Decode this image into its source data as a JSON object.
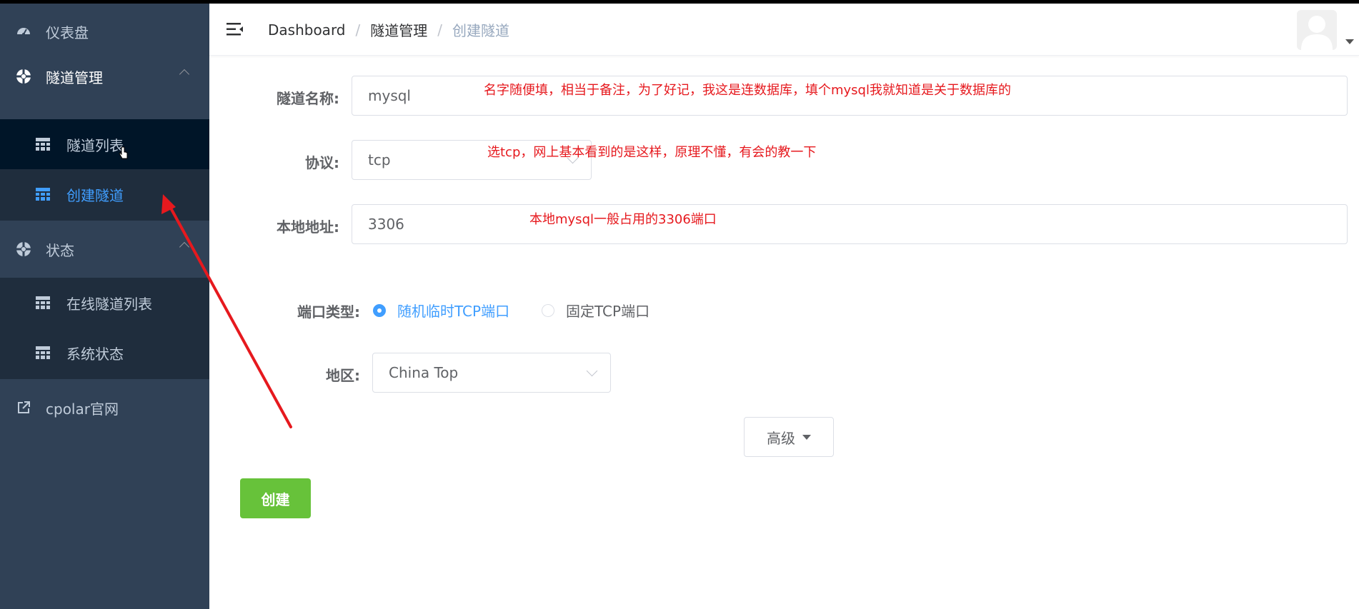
{
  "sidebar": {
    "dashboard": {
      "label": "仪表盘",
      "icon": "dashboard-icon"
    },
    "tunnel_mgmt": {
      "label": "隧道管理",
      "icon": "lifebuoy-icon"
    },
    "tunnel_list": {
      "label": "隧道列表",
      "icon": "table-icon"
    },
    "create_tunnel": {
      "label": "创建隧道",
      "icon": "table-icon"
    },
    "status": {
      "label": "状态",
      "icon": "lifebuoy-icon"
    },
    "online_tunnels": {
      "label": "在线隧道列表",
      "icon": "table-icon"
    },
    "system_status": {
      "label": "系统状态",
      "icon": "table-icon"
    },
    "official_site": {
      "label": "cpolar官网",
      "icon": "external-link-icon"
    }
  },
  "header": {
    "breadcrumb": [
      "Dashboard",
      "隧道管理",
      "创建隧道"
    ],
    "separator": "/"
  },
  "form": {
    "name": {
      "label": "隧道名称:",
      "value": "mysql",
      "note": "名字随便填，相当于备注，为了好记，我这是连数据库，填个mysql我就知道是关于数据库的"
    },
    "protocol": {
      "label": "协议:",
      "value": "tcp",
      "note": "选tcp，网上基本看到的是这样，原理不懂，有会的教一下"
    },
    "local_addr": {
      "label": "本地地址:",
      "value": "3306",
      "note": "本地mysql一般占用的3306端口"
    },
    "port_type": {
      "label": "端口类型:",
      "options": [
        "随机临时TCP端口",
        "固定TCP端口"
      ],
      "selected": "随机临时TCP端口"
    },
    "region": {
      "label": "地区:",
      "value": "China Top"
    },
    "advanced_label": "高级",
    "create_label": "创建"
  },
  "colors": {
    "sidebar_bg": "#304156",
    "submenu_bg": "#1f2d3d",
    "active": "#409eff",
    "annotation": "#e6191e",
    "create_button": "#67c23a"
  }
}
